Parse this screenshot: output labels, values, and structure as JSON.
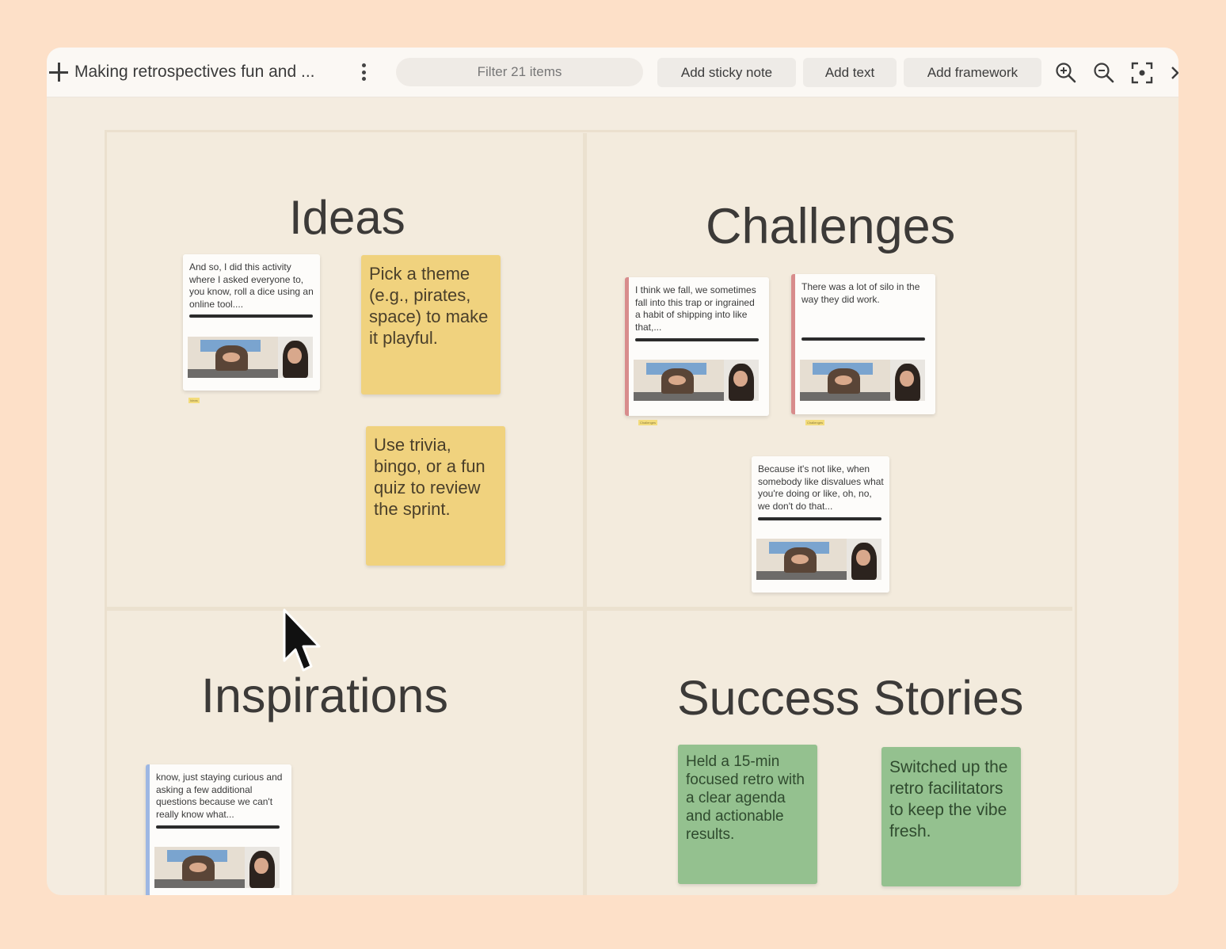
{
  "toolbar": {
    "title": "Making retrospectives fun and ...",
    "filter_placeholder": "Filter 21 items",
    "add_sticky_note": "Add sticky note",
    "add_text": "Add text",
    "add_framework": "Add framework",
    "icons": [
      "plus-icon",
      "kebab-menu-icon",
      "zoom-in-icon",
      "zoom-out-icon",
      "fit-to-screen-icon",
      "chevron-right-icon"
    ]
  },
  "sections": {
    "ideas": {
      "title": "Ideas",
      "video_card": {
        "text": "And so, I did this activity where I asked everyone to, you know, roll a dice using an online tool....",
        "tag": "Ideas"
      },
      "stickies": [
        "Pick a theme (e.g., pirates, space) to make it playful.",
        "Use trivia, bingo, or a fun quiz to review the sprint."
      ]
    },
    "challenges": {
      "title": "Challenges",
      "video_cards": [
        {
          "text": "I think we fall, we sometimes fall into this trap or ingrained a habit of shipping into like that,...",
          "tag": "Challenges"
        },
        {
          "text": "There was a lot of silo in the way they did work.",
          "tag": "Challenges"
        },
        {
          "text": "Because it's not like, when somebody like disvalues what you're doing or like, oh, no, we don't do that...",
          "tag": ""
        }
      ]
    },
    "inspirations": {
      "title": "Inspirations",
      "video_card": {
        "text": "know, just staying curious and asking a few additional questions because we can't really know what..."
      }
    },
    "success_stories": {
      "title": "Success Stories",
      "stickies": [
        "Held a 15-min focused retro with a clear agenda and actionable results.",
        "Switched up the retro facilitators to keep the vibe fresh."
      ]
    }
  },
  "colors": {
    "page_background": "#fde0c8",
    "board_background": "#f4ece0",
    "sticky_yellow": "#f0d27e",
    "sticky_green": "#94c18f",
    "challenge_accent": "#d88c8c",
    "inspiration_accent": "#9db7e3"
  }
}
